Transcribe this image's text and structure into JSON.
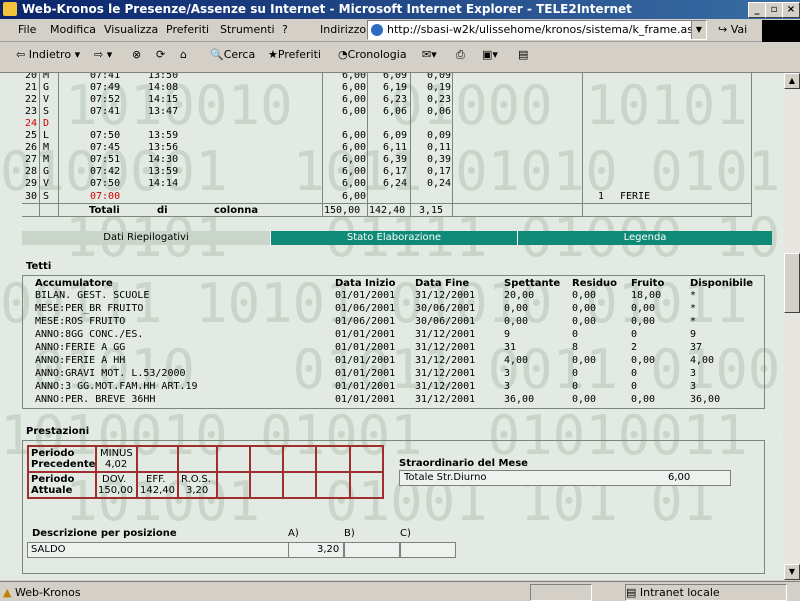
{
  "window": {
    "title": "Web-Kronos le Presenze/Assenze su Internet - Microsoft Internet Explorer - TELE2Internet",
    "minimize": "_",
    "maximize": "▫",
    "close": "×"
  },
  "menu": {
    "items": [
      "File",
      "Modifica",
      "Visualizza",
      "Preferiti",
      "Strumenti",
      "?"
    ]
  },
  "address": {
    "label": "Indirizzo",
    "url": "http://sbasi-w2k/ulissehome/kronos/sistema/k_frame.asp",
    "go": "Vai"
  },
  "toolbar": {
    "back": "Indietro",
    "search": "Cerca",
    "favorites": "Preferiti",
    "history": "Cronologia"
  },
  "days": {
    "rows": [
      {
        "d": "20 M",
        "a": "07:41",
        "b": "13:50",
        "t": "6,00",
        "e": "6,09",
        "s": "0,09",
        "red": false
      },
      {
        "d": "21 G",
        "a": "07:49",
        "b": "14:08",
        "t": "6,00",
        "e": "6,19",
        "s": "0,19",
        "red": false
      },
      {
        "d": "22 V",
        "a": "07:52",
        "b": "14:15",
        "t": "6,00",
        "e": "6,23",
        "s": "0,23",
        "red": false
      },
      {
        "d": "23 S",
        "a": "07:41",
        "b": "13:47",
        "t": "6,00",
        "e": "6,06",
        "s": "0,06",
        "red": false
      },
      {
        "d": "24 D",
        "a": "",
        "b": "",
        "t": "",
        "e": "",
        "s": "",
        "red": true
      },
      {
        "d": "25 L",
        "a": "07:50",
        "b": "13:59",
        "t": "6,00",
        "e": "6,09",
        "s": "0,09",
        "red": false
      },
      {
        "d": "26 M",
        "a": "07:45",
        "b": "13:56",
        "t": "6,00",
        "e": "6,11",
        "s": "0,11",
        "red": false
      },
      {
        "d": "27 M",
        "a": "07:51",
        "b": "14:30",
        "t": "6,00",
        "e": "6,39",
        "s": "0,39",
        "red": false
      },
      {
        "d": "28 G",
        "a": "07:42",
        "b": "13:59",
        "t": "6,00",
        "e": "6,17",
        "s": "0,17",
        "red": false
      },
      {
        "d": "29 V",
        "a": "07:50",
        "b": "14:14",
        "t": "6,00",
        "e": "6,24",
        "s": "0,24",
        "red": false
      }
    ],
    "last": {
      "d": "30 S",
      "a": "07:00",
      "t": "6,00",
      "note_n": "1",
      "note": "FERIE"
    },
    "totals": {
      "w1": "Totali",
      "w2": "di",
      "w3": "colonna",
      "t": "150,00",
      "e": "142,40",
      "s": "3,15"
    }
  },
  "tabs": [
    "Dati Riepilogativi",
    "Stato Elaborazione",
    "Legenda"
  ],
  "tetti": {
    "title": "Tetti",
    "headers": [
      "Accumulatore",
      "Data Inizio",
      "Data Fine",
      "Spettante",
      "Residuo",
      "Fruito",
      "Disponibile"
    ],
    "rows": [
      [
        "BILAN. GEST. SCUOLE",
        "01/01/2001",
        "31/12/2001",
        "20,00",
        "0,00",
        "18,00",
        "*"
      ],
      [
        "MESE:PER_BR FRUITO",
        "01/06/2001",
        "30/06/2001",
        "0,00",
        "0,00",
        "0,00",
        "*"
      ],
      [
        "MESE:ROS FRUITO",
        "01/06/2001",
        "30/06/2001",
        "0,00",
        "0,00",
        "0,00",
        "*"
      ],
      [
        "ANNO:8GG CONC./ES.",
        "01/01/2001",
        "31/12/2001",
        "9",
        "0",
        "0",
        "9"
      ],
      [
        "ANNO:FERIE A GG",
        "01/01/2001",
        "31/12/2001",
        "31",
        "8",
        "2",
        "37"
      ],
      [
        "ANNO:FERIE A HH",
        "01/01/2001",
        "31/12/2001",
        "4,00",
        "0,00",
        "0,00",
        "4,00"
      ],
      [
        "ANNO:GRAVI MOT. L.53/2000",
        "01/01/2001",
        "31/12/2001",
        "3",
        "0",
        "0",
        "3"
      ],
      [
        "ANNO:3 GG.MOT.FAM.HH ART.19",
        "01/01/2001",
        "31/12/2001",
        "3",
        "0",
        "0",
        "3"
      ],
      [
        "ANNO:PER. BREVE 36HH",
        "01/01/2001",
        "31/12/2001",
        "36,00",
        "0,00",
        "0,00",
        "36,00"
      ]
    ]
  },
  "prestazioni": {
    "title": "Prestazioni",
    "prec_label": "Periodo Precedente",
    "prec_code": "MINUS",
    "prec_value": "4,02",
    "att_label": "Periodo Attuale",
    "att": [
      {
        "code": "DOV.",
        "value": "150,00"
      },
      {
        "code": "EFF.",
        "value": "142,40"
      },
      {
        "code": "R.O.S.",
        "value": "3,20"
      }
    ],
    "straord_title": "Straordinario del Mese",
    "straord_label": "Totale Str.Diurno",
    "straord_value": "6,00",
    "desc_title": "Descrizione per posizione",
    "cols": [
      "A)",
      "B)",
      "C)"
    ],
    "desc_row": "SALDO",
    "desc_a": "3,20"
  },
  "status": {
    "text": "Web-Kronos",
    "zone": "Intranet locale"
  },
  "colors": {
    "tab_green": "#0e8a76",
    "bg_green": "#e3eae3",
    "title_blue": "#0a246a",
    "grid_red": "#a03030"
  }
}
